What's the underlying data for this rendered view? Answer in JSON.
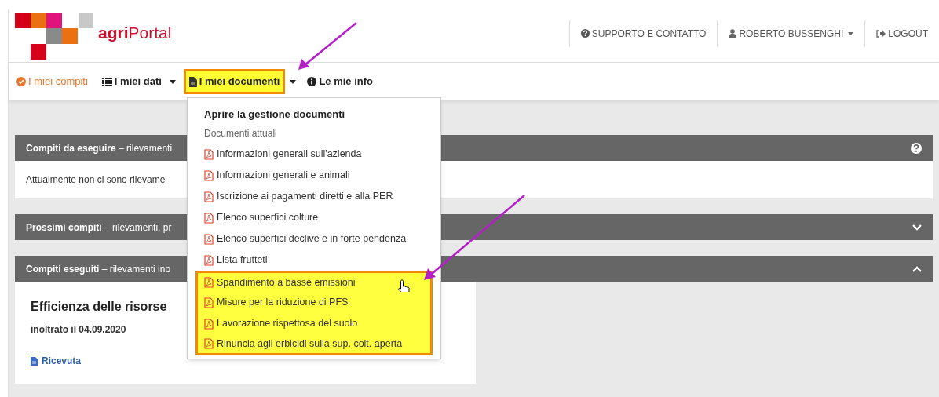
{
  "header": {
    "logo": {
      "bold": "agri",
      "rest": "Portal"
    },
    "links": [
      {
        "kind": "help",
        "label": "SUPPORTO E CONTATTO",
        "caret": false
      },
      {
        "kind": "user",
        "label": "ROBERTO BUSSENGHI",
        "caret": true
      },
      {
        "kind": "logout",
        "label": "LOGOUT",
        "caret": false
      }
    ]
  },
  "nav": [
    {
      "kind": "check",
      "label": "I miei compiti",
      "selected": true,
      "caret": false,
      "highlighted": false
    },
    {
      "kind": "list",
      "label": "I miei dati",
      "selected": false,
      "caret": true,
      "highlighted": false
    },
    {
      "kind": "file",
      "label": "I miei documenti",
      "selected": false,
      "caret": true,
      "highlighted": true
    },
    {
      "kind": "info",
      "label": "Le mie info",
      "selected": false,
      "caret": false,
      "highlighted": false
    }
  ],
  "dropdown": {
    "title": "Aprire la gestione documenti",
    "section": "Documenti attuali",
    "items": [
      {
        "label": "Informazioni generali sull'azienda",
        "hovered": false,
        "highlighted": false
      },
      {
        "label": "Informazioni generali e animali",
        "hovered": false,
        "highlighted": false
      },
      {
        "label": "Iscrizione ai pagamenti diretti e alla PER",
        "hovered": false,
        "highlighted": false
      },
      {
        "label": "Elenco superfici colture",
        "hovered": false,
        "highlighted": false
      },
      {
        "label": "Elenco superfici declive e in forte pendenza",
        "hovered": false,
        "highlighted": false
      },
      {
        "label": "Lista frutteti",
        "hovered": false,
        "highlighted": false
      },
      {
        "label": "Spandimento a basse emissioni",
        "hovered": true,
        "highlighted": true
      },
      {
        "label": "Misure per la riduzione di PFS",
        "hovered": false,
        "highlighted": true
      },
      {
        "label": "Lavorazione rispettosa del suolo",
        "hovered": false,
        "highlighted": true
      },
      {
        "label": "Rinuncia agli erbicidi sulla sup. colt. aperta",
        "hovered": false,
        "highlighted": true
      }
    ]
  },
  "panels": [
    {
      "title": "Compiti da eseguire",
      "subtitle": "– rilevamenti",
      "kind": "help",
      "expanded": true,
      "body": "Attualmente non ci sono rilevame"
    },
    {
      "title": "Prossimi compiti",
      "subtitle": "– rilevamenti, pr",
      "kind": "chevron",
      "expanded": false
    },
    {
      "title": "Compiti eseguiti",
      "subtitle": "– rilevamenti ino",
      "kind": "chevron",
      "expanded": true,
      "card": {
        "title": "Efficienza delle risorse",
        "date": "inoltrato il 04.09.2020",
        "link": "Ricevuta"
      }
    }
  ]
}
